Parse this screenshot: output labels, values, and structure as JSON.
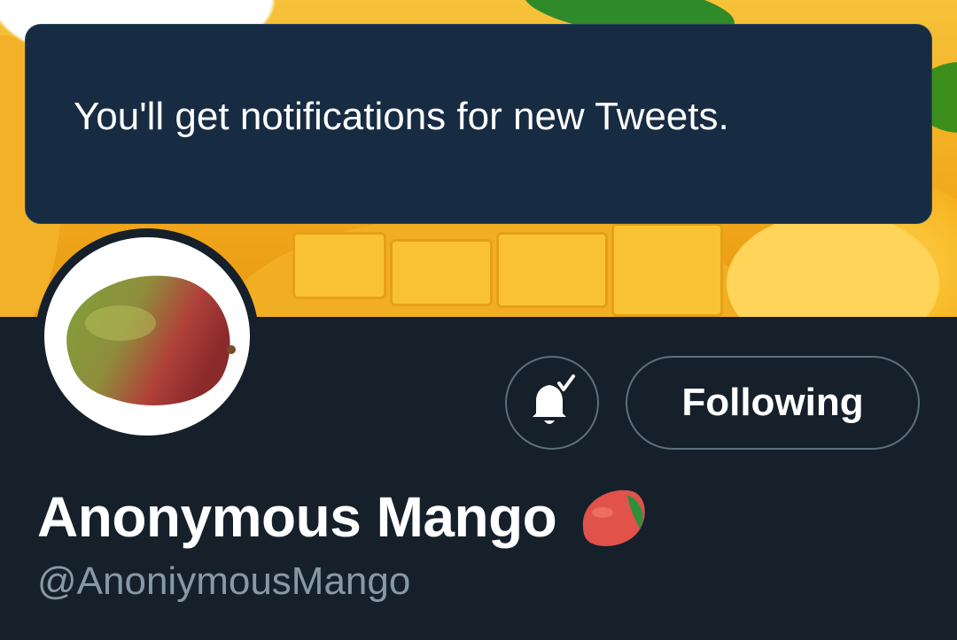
{
  "toast": {
    "message": "You'll get notifications for new Tweets."
  },
  "profile": {
    "display_name": "Anonymous Mango",
    "name_emoji": "mango-icon",
    "handle": "@AnoniymousMango",
    "avatar_image": "mango-icon"
  },
  "actions": {
    "notifications_icon": "bell-with-check-icon",
    "following_label": "Following"
  },
  "colors": {
    "background": "#15202b",
    "toast_background": "#172c42",
    "button_border": "#5c6f7e",
    "handle_text": "#8899a6",
    "name_text": "#ffffff"
  }
}
